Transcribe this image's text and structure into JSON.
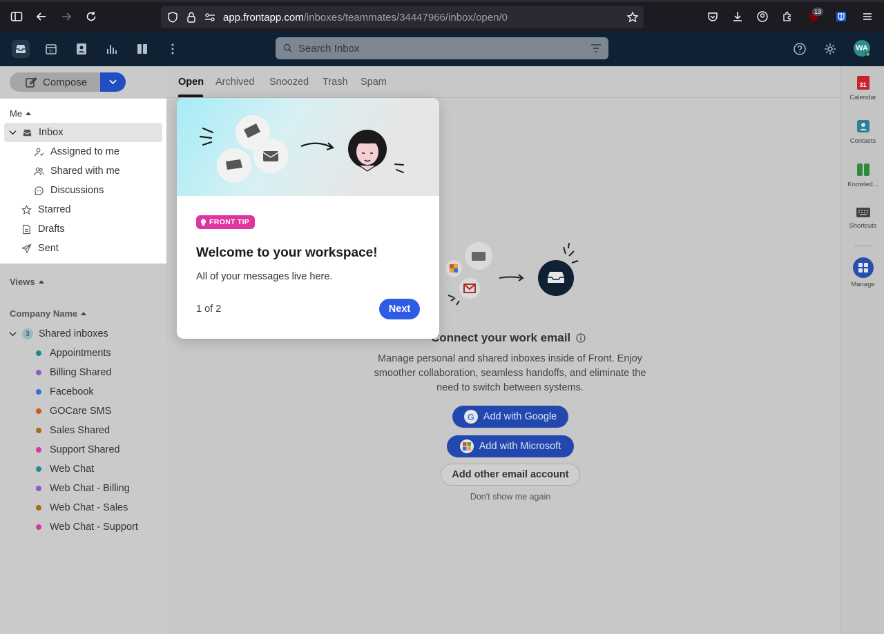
{
  "browser": {
    "url_host": "app.frontapp.com",
    "url_path": "/inboxes/teammates/34447966/inbox/open/0",
    "extension_badge": "13"
  },
  "app_bar": {
    "search_placeholder": "Search Inbox",
    "avatar_initials": "WA"
  },
  "sidebar": {
    "compose_label": "Compose",
    "me_header": "Me",
    "me_items": [
      {
        "label": "Inbox"
      },
      {
        "label": "Assigned to me"
      },
      {
        "label": "Shared with me"
      },
      {
        "label": "Discussions"
      },
      {
        "label": "Starred"
      },
      {
        "label": "Drafts"
      },
      {
        "label": "Sent"
      }
    ],
    "views_header": "Views",
    "company_header": "Company Name",
    "shared_inboxes": {
      "label": "Shared inboxes",
      "count": "3",
      "items": [
        {
          "label": "Appointments",
          "color": "#1e8a8c"
        },
        {
          "label": "Billing Shared",
          "color": "#8b5cc7"
        },
        {
          "label": "Facebook",
          "color": "#3b6fd1"
        },
        {
          "label": "GOCare SMS",
          "color": "#d0561d"
        },
        {
          "label": "Sales Shared",
          "color": "#a86a12"
        },
        {
          "label": "Support Shared",
          "color": "#cf3aa0"
        },
        {
          "label": "Web Chat",
          "color": "#1e8a8c"
        },
        {
          "label": "Web Chat - Billing",
          "color": "#8b5cc7"
        },
        {
          "label": "Web Chat - Sales",
          "color": "#a86a12"
        },
        {
          "label": "Web Chat - Support",
          "color": "#cf3aa0"
        }
      ]
    }
  },
  "main": {
    "tabs": [
      {
        "label": "Open"
      },
      {
        "label": "Archived"
      },
      {
        "label": "Snoozed"
      },
      {
        "label": "Trash"
      },
      {
        "label": "Spam"
      }
    ],
    "connect_title": "Connect your work email",
    "connect_desc": "Manage personal and shared inboxes inside of Front. Enjoy smoother collaboration, seamless handoffs, and eliminate the need to switch between systems.",
    "google_btn": "Add with Google",
    "google_logo": "G",
    "microsoft_btn": "Add with Microsoft",
    "other_btn": "Add other email account",
    "dont_show": "Don't show me again"
  },
  "rail": {
    "items": [
      {
        "label": "Calendar",
        "icon_text": "31"
      },
      {
        "label": "Contacts"
      },
      {
        "label": "Knowled..."
      },
      {
        "label": "Shortcuts"
      },
      {
        "label": "Manage"
      }
    ]
  },
  "tip": {
    "badge": "FRONT TIP",
    "title": "Welcome to your workspace!",
    "body": "All of your messages live here.",
    "step": "1 of 2",
    "next": "Next"
  },
  "colors": {
    "accent_blue": "#2f5ce6",
    "tip_pink": "#e0349f",
    "app_bar": "#0f2133"
  }
}
